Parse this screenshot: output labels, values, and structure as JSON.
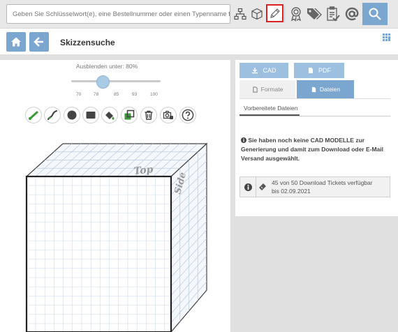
{
  "search": {
    "placeholder": "Geben Sie Schlüsselwort(e), eine Bestellnummer oder einen Typenname für"
  },
  "toolbar_icons": [
    "hierarchy-icon",
    "cube-icon",
    "pencil-icon",
    "award-icon",
    "tags-icon",
    "checklist-icon",
    "at-icon",
    "search-icon"
  ],
  "page": {
    "title": "Skizzensuche"
  },
  "slider": {
    "label": "Ausblenden unter: 80%",
    "ticks": [
      "70",
      "78",
      "85",
      "93",
      "100"
    ],
    "value_percent": 80
  },
  "drawing_tools": [
    "line-icon",
    "pen-tool-icon",
    "circle-icon",
    "rectangle-icon",
    "fill-icon",
    "layer-icon",
    "trash-icon",
    "camera-icon",
    "help-icon"
  ],
  "cube": {
    "top_label": "Top",
    "side_label": "Side"
  },
  "right": {
    "cad_label": "CAD",
    "pdf_label": "PDF",
    "formate_label": "Formate",
    "dateien_label": "Dateien",
    "prepared_label": "Vorbereitete Dateien",
    "message": "Sie haben noch keine CAD MODELLE zur Generierung und damit zum Download oder E-Mail Versand ausgewählt.",
    "tickets_line1": "45 von 50 Download Tickets verfügbar",
    "tickets_line2": "bis 02.09.2021"
  },
  "colors": {
    "accent": "#7ba6cf",
    "highlight": "#e02020",
    "tool_green": "#3a9a3a"
  }
}
